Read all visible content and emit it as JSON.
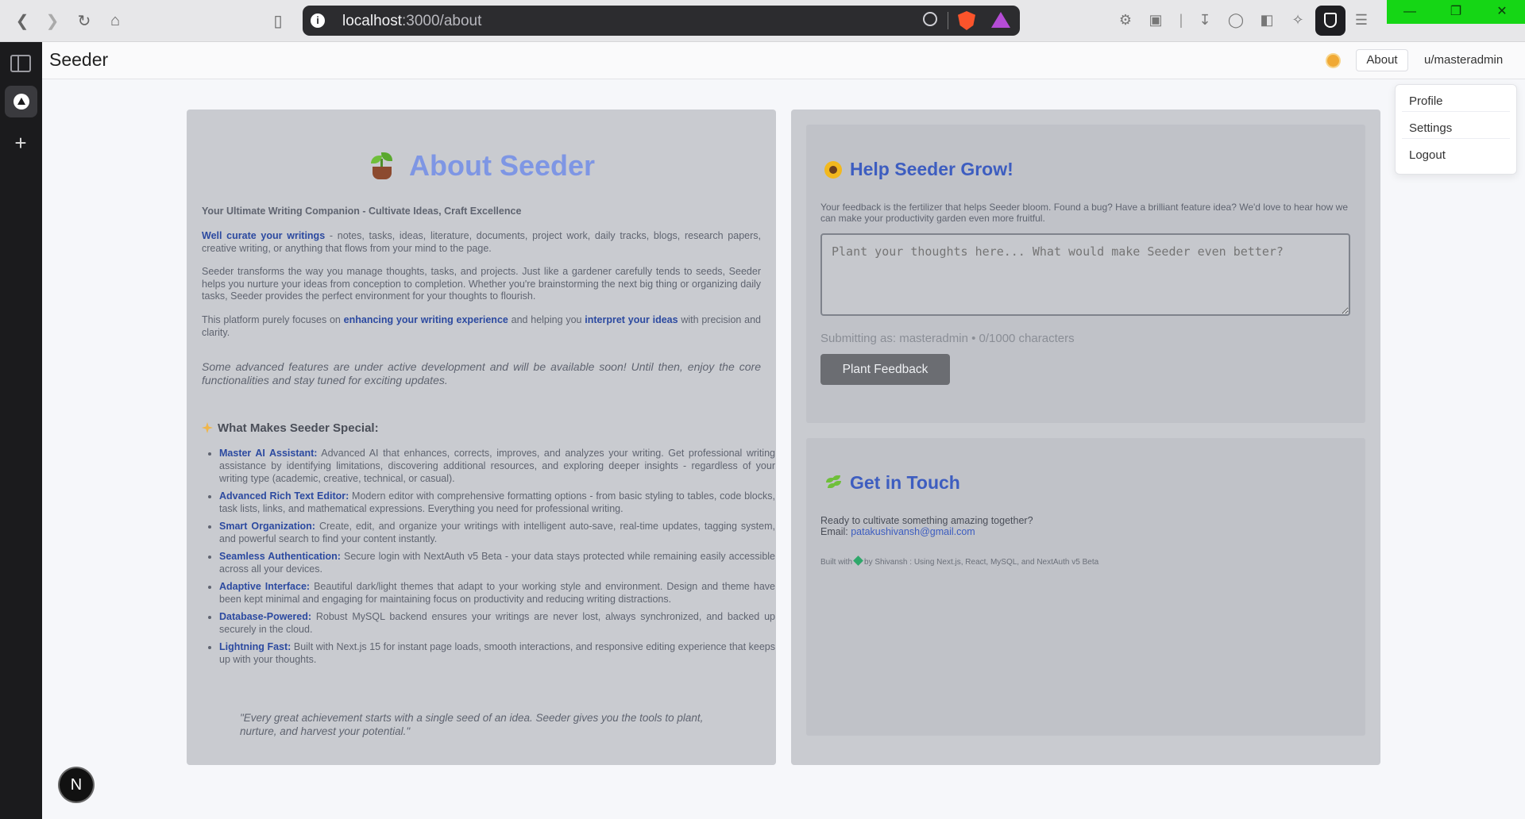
{
  "browser": {
    "url_host": "localhost",
    "url_path": ":3000/about"
  },
  "header": {
    "brand": "Seeder",
    "about_label": "About",
    "user_label": "u/masteradmin"
  },
  "user_menu": {
    "items": [
      "Profile",
      "Settings",
      "Logout"
    ]
  },
  "about": {
    "title": "About Seeder",
    "tagline": "Your Ultimate Writing Companion - Cultivate Ideas, Craft Excellence",
    "p1_strong": "Well curate your writings",
    "p1_rest": " - notes, tasks, ideas, literature, documents, project work, daily tracks, blogs, research papers, creative writing, or anything that flows from your mind to the page.",
    "p2": "Seeder transforms the way you manage thoughts, tasks, and projects. Just like a gardener carefully tends to seeds, Seeder helps you nurture your ideas from conception to completion. Whether you're brainstorming the next big thing or organizing daily tasks, Seeder provides the perfect environment for your thoughts to flourish.",
    "p3_a": "This platform purely focuses on ",
    "p3_strong1": "enhancing your writing experience",
    "p3_b": " and helping you ",
    "p3_strong2": "interpret your ideas",
    "p3_c": " with precision and clarity.",
    "notice": "Some advanced features are under active development and will be available soon! Until then, enjoy the core functionalities and stay tuned for exciting updates.",
    "special_heading": "What Makes Seeder Special:",
    "features": [
      {
        "name": "Master AI Assistant:",
        "desc": " Advanced AI that enhances, corrects, improves, and analyzes your writing. Get professional writing assistance by identifying limitations, discovering additional resources, and exploring deeper insights - regardless of your writing type (academic, creative, technical, or casual)."
      },
      {
        "name": "Advanced Rich Text Editor:",
        "desc": " Modern editor with comprehensive formatting options - from basic styling to tables, code blocks, task lists, links, and mathematical expressions. Everything you need for professional writing."
      },
      {
        "name": "Smart Organization:",
        "desc": " Create, edit, and organize your writings with intelligent auto-save, real-time updates, tagging system, and powerful search to find your content instantly."
      },
      {
        "name": "Seamless Authentication:",
        "desc": " Secure login with NextAuth v5 Beta - your data stays protected while remaining easily accessible across all your devices."
      },
      {
        "name": "Adaptive Interface:",
        "desc": " Beautiful dark/light themes that adapt to your working style and environment. Design and theme have been kept minimal and engaging for maintaining focus on productivity and reducing writing distractions."
      },
      {
        "name": "Database-Powered:",
        "desc": " Robust MySQL backend ensures your writings are never lost, always synchronized, and backed up securely in the cloud."
      },
      {
        "name": "Lightning Fast:",
        "desc": " Built with Next.js 15 for instant page loads, smooth interactions, and responsive editing experience that keeps up with your thoughts."
      }
    ],
    "quote": "\"Every great achievement starts with a single seed of an idea. Seeder gives you the tools to plant, nurture, and harvest your potential.\""
  },
  "help": {
    "title": "Help Seeder Grow!",
    "description": "Your feedback is the fertilizer that helps Seeder bloom. Found a bug? Have a brilliant feature idea? We'd love to hear how we can make your productivity garden even more fruitful.",
    "placeholder": "Plant your thoughts here... What would make Seeder even better?",
    "counter": "Submitting as: masteradmin • 0/1000 characters",
    "button": "Plant Feedback"
  },
  "contact": {
    "title": "Get in Touch",
    "line1": "Ready to cultivate something amazing together?",
    "email_label": "Email: ",
    "email": "patakushivansh@gmail.com",
    "built_prefix": "Built with",
    "built_suffix": "by Shivansh : Using Next.js, React, MySQL, and NextAuth v5 Beta"
  },
  "dev_badge": "N",
  "colors": {
    "accent_blue": "#3d5dc0",
    "title_blue": "#7e96e4",
    "button_gray": "#6b6d72"
  }
}
